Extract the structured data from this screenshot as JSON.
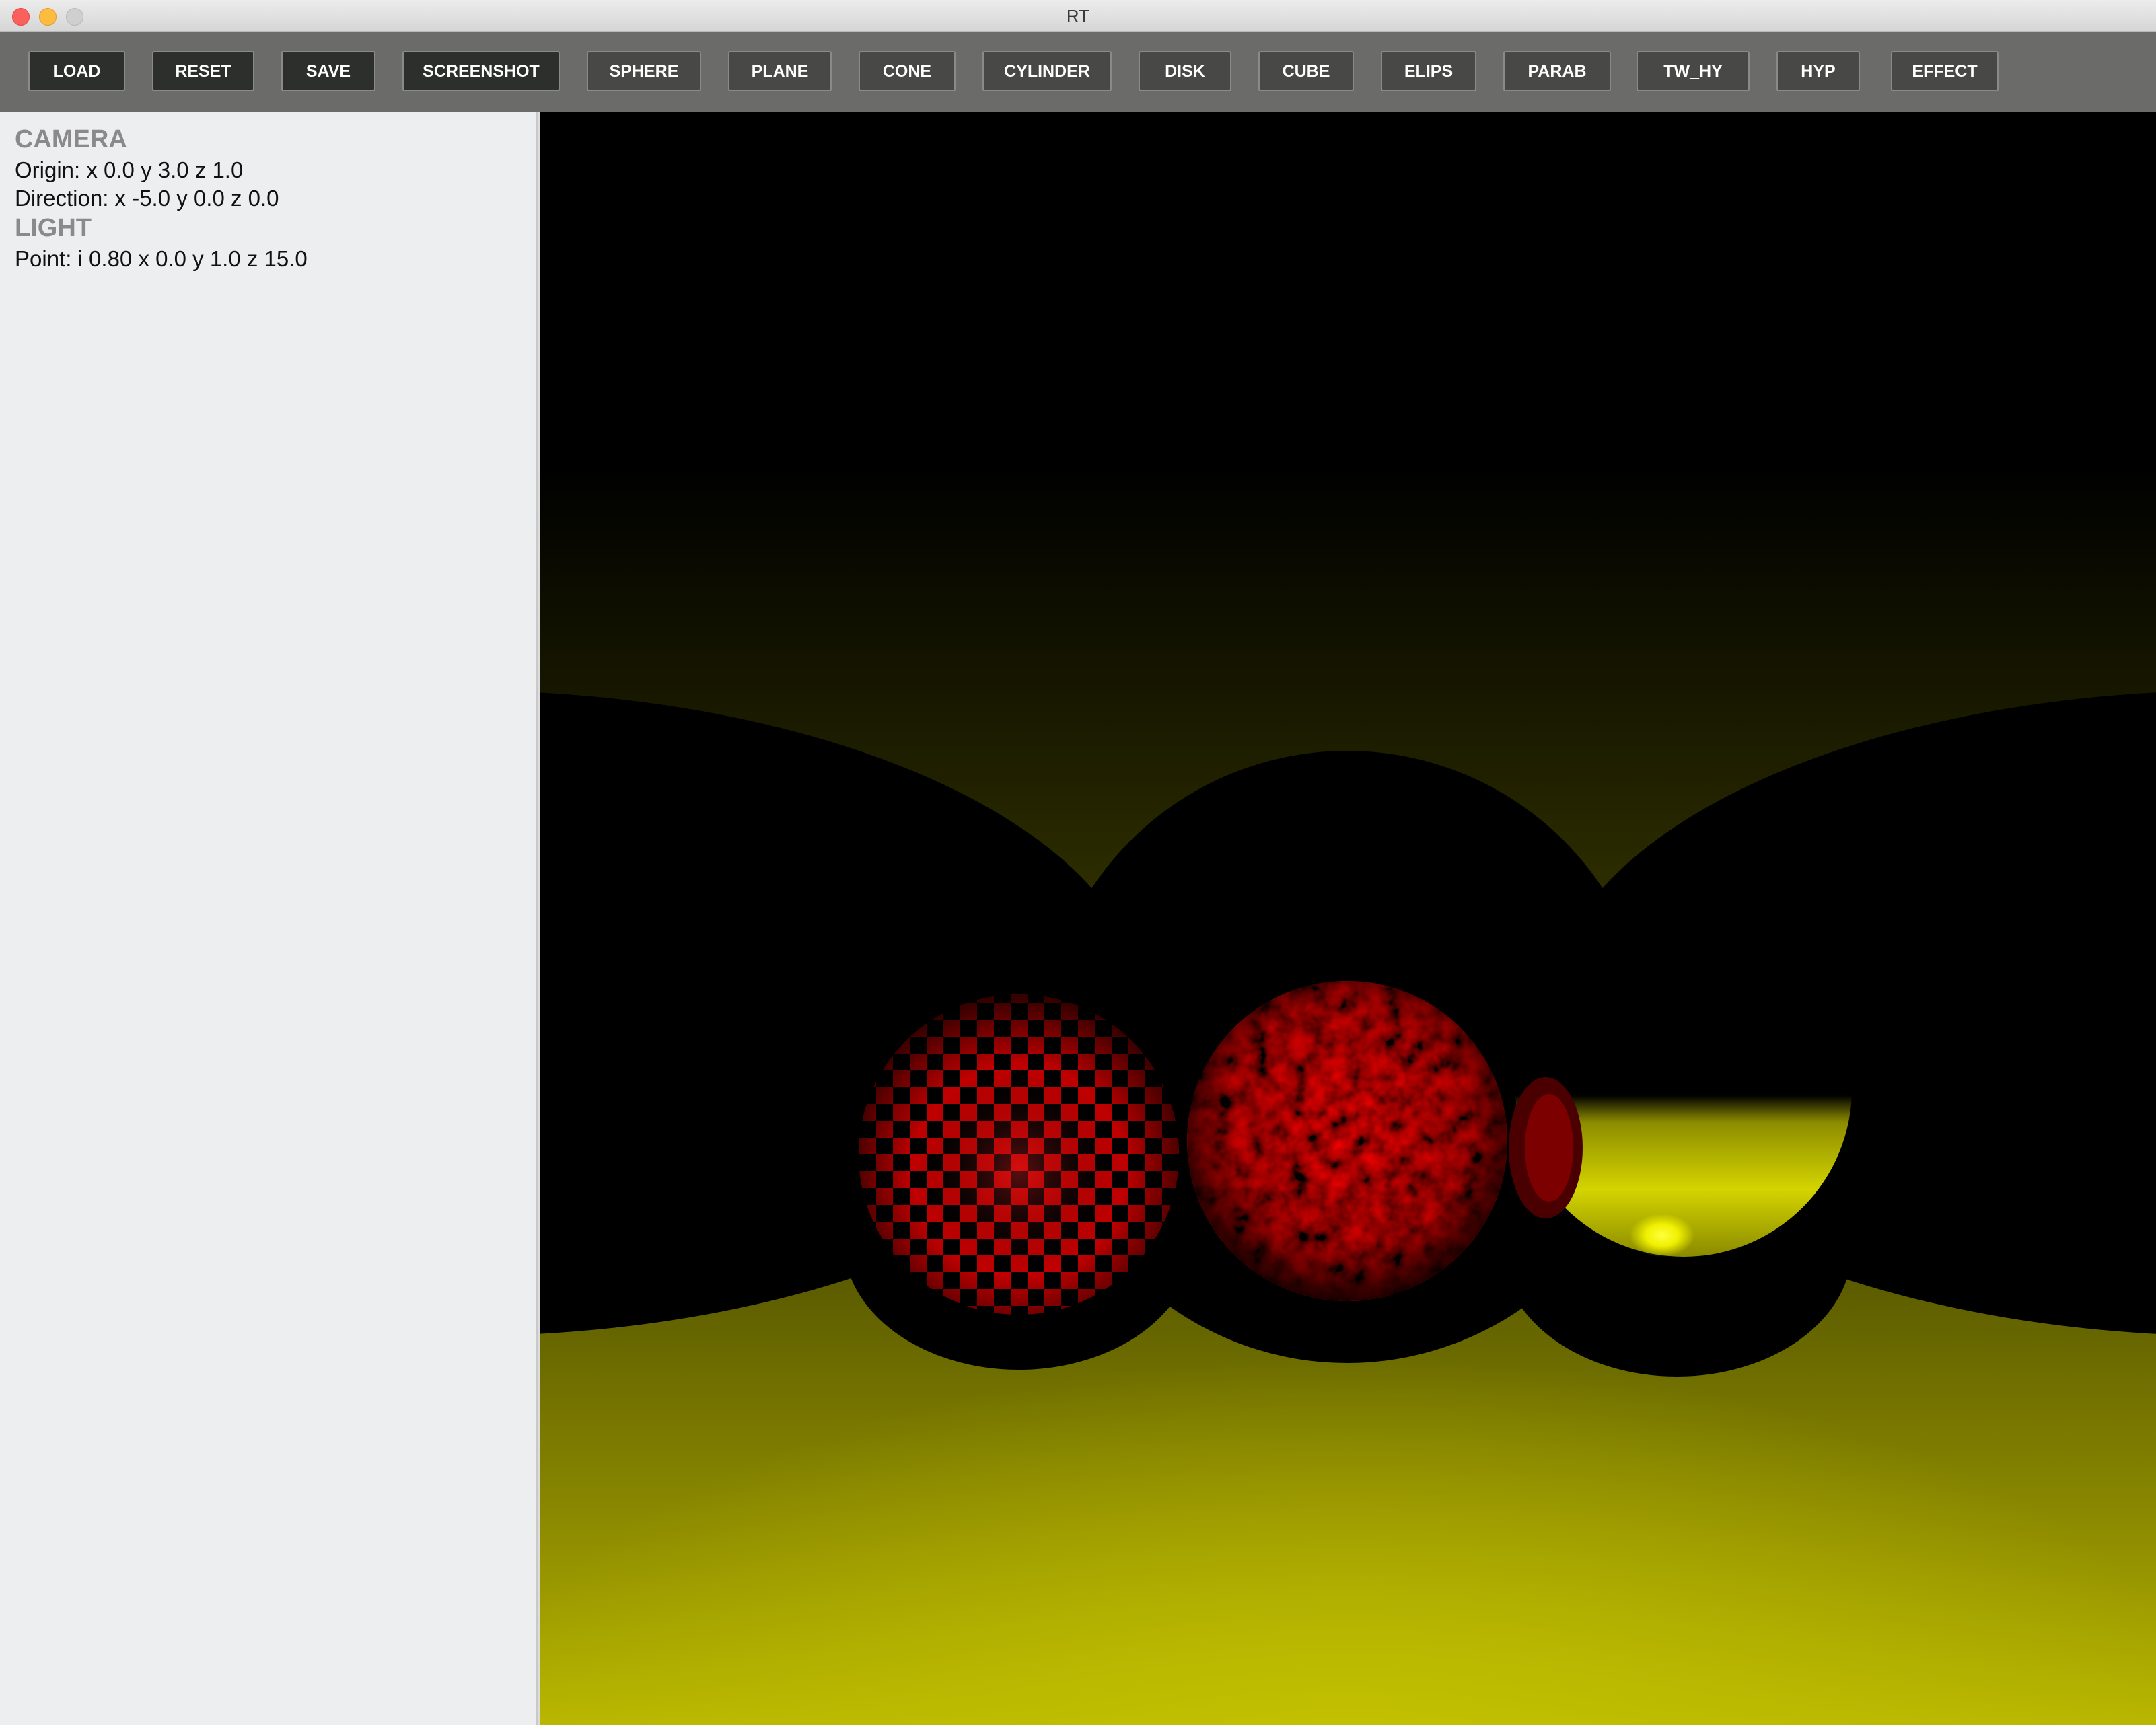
{
  "window": {
    "title": "RT"
  },
  "toolbar": {
    "buttons": [
      {
        "label": "LOAD"
      },
      {
        "label": "RESET"
      },
      {
        "label": "SAVE"
      },
      {
        "label": "SCREENSHOT"
      },
      {
        "label": "SPHERE"
      },
      {
        "label": "PLANE"
      },
      {
        "label": "CONE"
      },
      {
        "label": "CYLINDER"
      },
      {
        "label": "DISK"
      },
      {
        "label": "CUBE"
      },
      {
        "label": "ELIPS"
      },
      {
        "label": "PARAB"
      },
      {
        "label": "TW_HY"
      },
      {
        "label": "HYP"
      },
      {
        "label": "EFFECT"
      }
    ]
  },
  "panel": {
    "camera_heading": "CAMERA",
    "camera_origin": "Origin: x 0.0 y 3.0 z 1.0",
    "camera_direction": "Direction: x -5.0 y 0.0 z 0.0",
    "light_heading": "LIGHT",
    "light_point": "Point: i 0.80 x 0.0 y 1.0 z 15.0"
  },
  "colors": {
    "floor": "#bdbb00",
    "checker_red": "#c00000",
    "noise_red": "#8a0000",
    "glossy_yellow": "#d0d000"
  }
}
